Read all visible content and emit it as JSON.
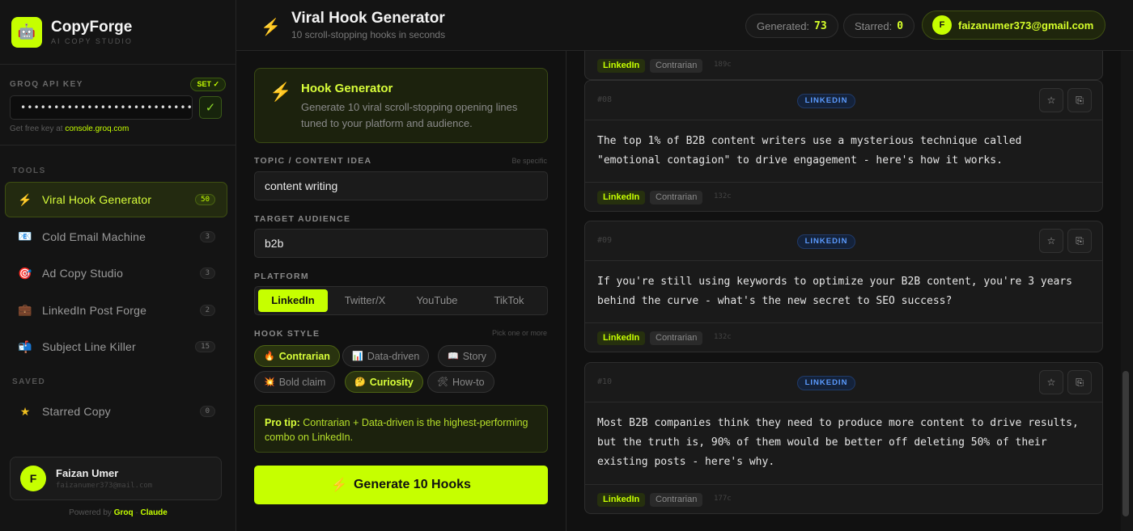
{
  "brand": {
    "name": "CopyForge",
    "subtitle": "AI COPY STUDIO",
    "logo_icon": "robot-icon"
  },
  "api": {
    "label": "GROQ API KEY",
    "status_badge": "SET ✓",
    "masked_value": "••••••••••••••••••••••••••••••••••••",
    "note_prefix": "Get free key at",
    "note_link": "console.groq.com"
  },
  "sidebar": {
    "tools_label": "TOOLS",
    "items": [
      {
        "label": "Viral Hook Generator",
        "icon": "⚡",
        "count": "50"
      },
      {
        "label": "Cold Email Machine",
        "icon": "📧",
        "count": "3"
      },
      {
        "label": "Ad Copy Studio",
        "icon": "🎯",
        "count": "3"
      },
      {
        "label": "LinkedIn Post Forge",
        "icon": "💼",
        "count": "2"
      },
      {
        "label": "Subject Line Killer",
        "icon": "📬",
        "count": "15"
      }
    ],
    "saved_label": "SAVED",
    "saved_items": [
      {
        "label": "Starred Copy",
        "icon": "★",
        "count": "0"
      }
    ]
  },
  "user": {
    "initial": "F",
    "name": "Faizan Umer",
    "email": "faizanumer373@mail.com"
  },
  "footer": {
    "powered_by": "Powered by",
    "provider_a": "Groq",
    "separator": "·",
    "provider_b": "Claude"
  },
  "header": {
    "icon": "⚡",
    "title": "Viral Hook Generator",
    "subtitle": "10 scroll-stopping hooks in seconds",
    "generated_label": "Generated:",
    "generated_value": "73",
    "starred_label": "Starred:",
    "starred_value": "0",
    "account_initial": "F",
    "account_email": "faizanumer373@gmail.com"
  },
  "form": {
    "card_title": "Hook Generator",
    "card_desc": "Generate 10 viral scroll-stopping opening lines tuned to your platform and audience.",
    "topic_label": "TOPIC / CONTENT IDEA",
    "topic_hint": "Be specific",
    "topic_value": "content writing",
    "audience_label": "TARGET AUDIENCE",
    "audience_value": "b2b",
    "platform_label": "PLATFORM",
    "platforms": [
      "LinkedIn",
      "Twitter/X",
      "YouTube",
      "TikTok"
    ],
    "style_label": "HOOK STYLE",
    "style_hint": "Pick one or more",
    "styles": [
      {
        "label": "Contrarian",
        "icon": "🔥"
      },
      {
        "label": "Data-driven",
        "icon": "📊"
      },
      {
        "label": "Story",
        "icon": "📖"
      },
      {
        "label": "Bold claim",
        "icon": "💥"
      },
      {
        "label": "Curiosity",
        "icon": "🤔"
      },
      {
        "label": "How-to",
        "icon": "🛠"
      }
    ],
    "tip_bold": "Pro tip:",
    "tip_text": "Contrarian + Data-driven is the highest-performing combo on LinkedIn.",
    "generate_label": "Generate 10 Hooks",
    "generate_icon": "⚡"
  },
  "results": {
    "partial": {
      "platform": "LinkedIn",
      "style": "Contrarian",
      "chars": "189c"
    },
    "hooks": [
      {
        "num": "#08",
        "platform_badge": "LINKEDIN",
        "text": "The top 1% of B2B content writers use a mysterious technique called \"emotional contagion\" to drive engagement - here's how it works.",
        "platform": "LinkedIn",
        "style": "Contrarian",
        "chars": "132c"
      },
      {
        "num": "#09",
        "platform_badge": "LINKEDIN",
        "text": "If you're still using keywords to optimize your B2B content, you're 3 years behind the curve - what's the new secret to SEO success?",
        "platform": "LinkedIn",
        "style": "Contrarian",
        "chars": "132c"
      },
      {
        "num": "#10",
        "platform_badge": "LINKEDIN",
        "text": "Most B2B companies think they need to produce more content to drive results, but the truth is, 90% of them would be better off deleting 50% of their existing posts - here's why.",
        "platform": "LinkedIn",
        "style": "Contrarian",
        "chars": "177c"
      }
    ],
    "star_icon": "☆",
    "copy_icon": "⎘"
  },
  "colors": {
    "accent": "#c6ff00",
    "background": "#111111",
    "badge_blue": "#5b9bff"
  }
}
